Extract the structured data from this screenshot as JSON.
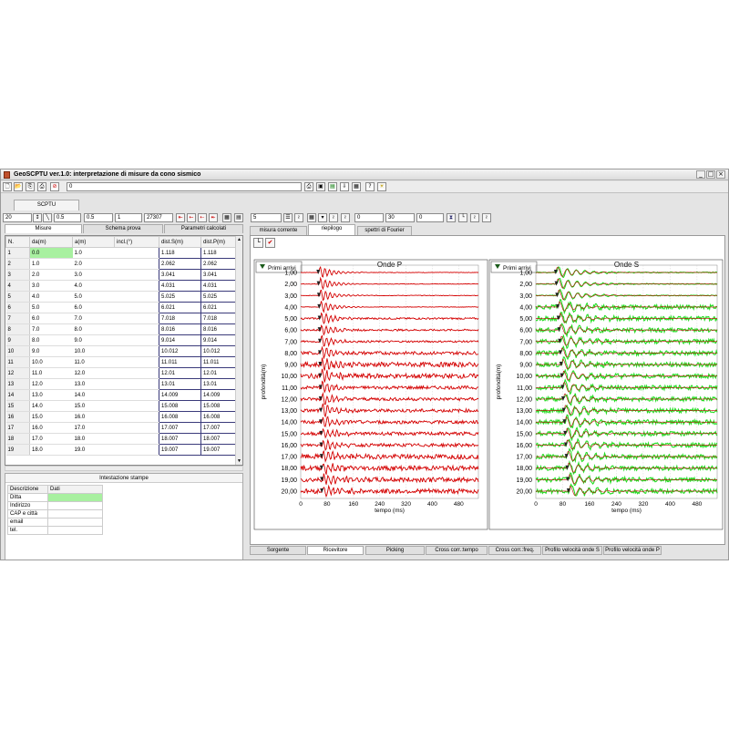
{
  "window": {
    "title": "GeoSCPTU ver.1.0: interpretazione di misure da cono sismico",
    "controls": [
      "_",
      "□",
      "×"
    ]
  },
  "toolbar": {
    "path_value": "0"
  },
  "document_tab": "SCPTU",
  "controls": {
    "v1": "20",
    "v2": "0.5",
    "v3": "0.5",
    "v4": "1",
    "v5": "27307",
    "v6": "5",
    "v7": "0",
    "v8": "30",
    "v9": "0"
  },
  "left_tabs": [
    "Misure",
    "Schema prova",
    "Parametri calcolati"
  ],
  "grid": {
    "headers": [
      "N.",
      "da(m)",
      "a(m)",
      "incl.(°)",
      "dist.S(m)",
      "dist.P(m)"
    ],
    "rows": [
      [
        "1",
        "0.0",
        "1.0",
        "",
        "1.118",
        "1.118"
      ],
      [
        "2",
        "1.0",
        "2.0",
        "",
        "2.062",
        "2.062"
      ],
      [
        "3",
        "2.0",
        "3.0",
        "",
        "3.041",
        "3.041"
      ],
      [
        "4",
        "3.0",
        "4.0",
        "",
        "4.031",
        "4.031"
      ],
      [
        "5",
        "4.0",
        "5.0",
        "",
        "5.025",
        "5.025"
      ],
      [
        "6",
        "5.0",
        "6.0",
        "",
        "6.021",
        "6.021"
      ],
      [
        "7",
        "6.0",
        "7.0",
        "",
        "7.018",
        "7.018"
      ],
      [
        "8",
        "7.0",
        "8.0",
        "",
        "8.016",
        "8.016"
      ],
      [
        "9",
        "8.0",
        "9.0",
        "",
        "9.014",
        "9.014"
      ],
      [
        "10",
        "9.0",
        "10.0",
        "",
        "10.012",
        "10.012"
      ],
      [
        "11",
        "10.0",
        "11.0",
        "",
        "11.011",
        "11.011"
      ],
      [
        "12",
        "11.0",
        "12.0",
        "",
        "12.01",
        "12.01"
      ],
      [
        "13",
        "12.0",
        "13.0",
        "",
        "13.01",
        "13.01"
      ],
      [
        "14",
        "13.0",
        "14.0",
        "",
        "14.009",
        "14.009"
      ],
      [
        "15",
        "14.0",
        "15.0",
        "",
        "15.008",
        "15.008"
      ],
      [
        "16",
        "15.0",
        "16.0",
        "",
        "16.008",
        "16.008"
      ],
      [
        "17",
        "16.0",
        "17.0",
        "",
        "17.007",
        "17.007"
      ],
      [
        "18",
        "17.0",
        "18.0",
        "",
        "18.007",
        "18.007"
      ],
      [
        "19",
        "18.0",
        "19.0",
        "",
        "19.007",
        "19.007"
      ]
    ]
  },
  "stampe": {
    "title": "Intestazione stampe",
    "headers": [
      "Descrizione",
      "Dati"
    ],
    "rows": [
      "Ditta",
      "Indirizzo",
      "CAP e città",
      "email",
      "tel."
    ]
  },
  "right_tabs": [
    "misura corrente",
    "riepilogo",
    "spettri di Fourier"
  ],
  "bottom_tabs": [
    "Sorgente",
    "Ricevitore",
    "Picking",
    "Cross corr.:tempo",
    "Cross corr.:freq.",
    "Profilo velocità onde S",
    "Profilo velocità onde P"
  ],
  "colors": {
    "p_trace": "#d40000",
    "s_trace": "#22dd22",
    "s_overlay": "#c00000",
    "selected": "#a8f0a0"
  },
  "chart_data": [
    {
      "type": "line",
      "title": "Onde P",
      "legend": "Primi arrivi",
      "xlabel": "tempo (ms)",
      "ylabel": "profondità(m)",
      "xticks": [
        "0",
        "80",
        "160",
        "240",
        "320",
        "400",
        "480"
      ],
      "yticks": [
        "1,00",
        "2,00",
        "3,00",
        "4,00",
        "5,00",
        "6,00",
        "7,00",
        "8,00",
        "9,00",
        "10,00",
        "11,00",
        "12,00",
        "13,00",
        "14,00",
        "15,00",
        "16,00",
        "17,00",
        "18,00",
        "19,00",
        "20,00"
      ],
      "xlim": [
        0,
        540
      ],
      "first_arrivals_ms": [
        56,
        57,
        58,
        59,
        60,
        60,
        61,
        61,
        62,
        62,
        63,
        63,
        64,
        64,
        65,
        65,
        66,
        66,
        67,
        67
      ]
    },
    {
      "type": "line",
      "title": "Onde S",
      "legend": "Primi arrivi",
      "xlabel": "tempo (ms)",
      "ylabel": "profondità(m)",
      "xticks": [
        "0",
        "80",
        "160",
        "240",
        "320",
        "400",
        "480"
      ],
      "yticks": [
        "1,00",
        "2,00",
        "3,00",
        "4,00",
        "5,00",
        "6,00",
        "7,00",
        "8,00",
        "9,00",
        "10,00",
        "11,00",
        "12,00",
        "13,00",
        "14,00",
        "15,00",
        "16,00",
        "17,00",
        "18,00",
        "19,00",
        "20,00"
      ],
      "xlim": [
        0,
        540
      ],
      "first_arrivals_ms": [
        62,
        64,
        66,
        68,
        70,
        72,
        74,
        76,
        78,
        80,
        82,
        84,
        86,
        88,
        90,
        92,
        94,
        96,
        98,
        100
      ]
    }
  ]
}
